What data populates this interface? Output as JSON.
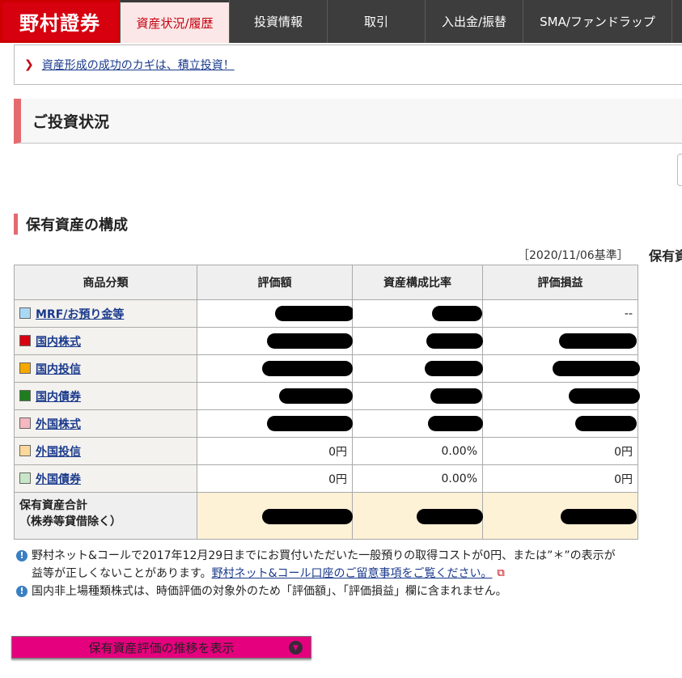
{
  "nav": {
    "logo": "野村證券",
    "tabs": [
      {
        "label": "資産状況/履歴",
        "active": true
      },
      {
        "label": "投資情報"
      },
      {
        "label": "取引"
      },
      {
        "label": "入出金/振替"
      },
      {
        "label": "SMA/ファンドラップ"
      }
    ]
  },
  "notice": {
    "link": "資産形成の成功のカギは、積立投資！"
  },
  "section_title": "ご投資状況",
  "subsection_title": "保有資産の構成",
  "base_date": "［2020/11/06基準］",
  "holding_label": "保有資",
  "table": {
    "headers": [
      "商品分類",
      "評価額",
      "資産構成比率",
      "評価損益"
    ],
    "rows": [
      {
        "category": "MRF/お預り金等",
        "color": "#a9d8f5",
        "value": "",
        "ratio": "",
        "pl": "--"
      },
      {
        "category": "国内株式",
        "color": "#d7000f",
        "value": "",
        "ratio": "",
        "pl": ""
      },
      {
        "category": "国内投信",
        "color": "#f5a800",
        "value": "",
        "ratio": "",
        "pl": ""
      },
      {
        "category": "国内債券",
        "color": "#1e7e1e",
        "value": "",
        "ratio": "",
        "pl": ""
      },
      {
        "category": "外国株式",
        "color": "#f5b7c0",
        "value": "",
        "ratio": "",
        "pl": ""
      },
      {
        "category": "外国投信",
        "color": "#fcd89a",
        "value": "0円",
        "ratio": "0.00%",
        "pl": "0円"
      },
      {
        "category": "外国債券",
        "color": "#c8e6c8",
        "value": "0円",
        "ratio": "0.00%",
        "pl": "0円"
      }
    ],
    "total_label_1": "保有資産合計",
    "total_label_2": "（株券等貸借除く）"
  },
  "notes": {
    "note1_line1": "野村ネット&コールで2017年12月29日までにお買付いただいた一般預りの取得コストが0円、または”＊”の表示が",
    "note1_line2_text": "益等が正しくないことがあります。",
    "note1_link": "野村ネット&コール口座のご留意事項をご覧ください。",
    "note2": "国内非上場種類株式は、時価評価の対象外のため「評価額」、「評価損益」欄に含まれません。",
    "excl_glyph": "!"
  },
  "trend_button": {
    "label": "保有資産評価の推移を表示",
    "icon": "chevron-down-icon"
  }
}
